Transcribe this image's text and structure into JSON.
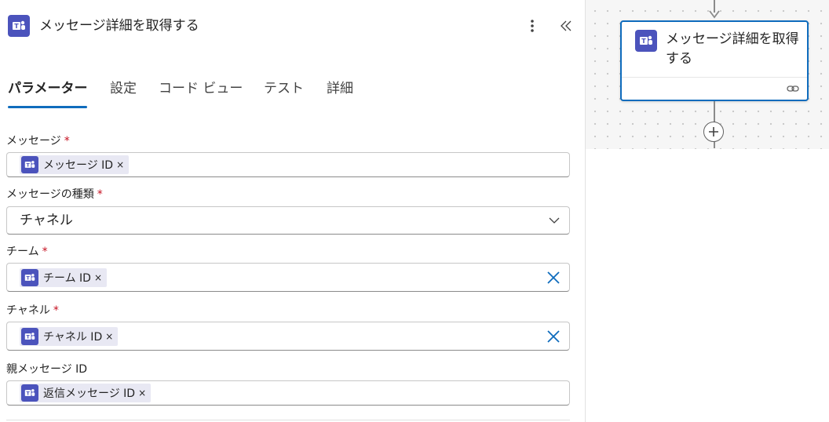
{
  "panel": {
    "title": "メッセージ詳細を取得する",
    "icon": "teams-icon",
    "more_icon": "more-vertical-icon",
    "collapse_icon": "double-chevron-left-icon",
    "tabs": [
      {
        "label": "パラメーター",
        "active": true
      },
      {
        "label": "設定",
        "active": false
      },
      {
        "label": "コード ビュー",
        "active": false
      },
      {
        "label": "テスト",
        "active": false
      },
      {
        "label": "詳細",
        "active": false
      }
    ],
    "required_mark": "*",
    "fields": {
      "message": {
        "label": "メッセージ",
        "required": true,
        "token": "メッセージ ID",
        "token_remove": "×"
      },
      "message_type": {
        "label": "メッセージの種類",
        "required": true,
        "value": "チャネル"
      },
      "team": {
        "label": "チーム",
        "required": true,
        "token": "チーム ID",
        "token_remove": "×"
      },
      "channel": {
        "label": "チャネル",
        "required": true,
        "token": "チャネル ID",
        "token_remove": "×"
      },
      "parent_message": {
        "label": "親メッセージ ID",
        "required": false,
        "token": "返信メッセージ ID",
        "token_remove": "×"
      }
    }
  },
  "canvas": {
    "card": {
      "title": "メッセージ詳細を取得する",
      "icon": "teams-icon",
      "link_icon": "link-icon"
    },
    "add_icon": "plus-circle-icon"
  },
  "colors": {
    "accent": "#0f6cbd",
    "teams": "#4b53bc",
    "required": "#c50f1f",
    "token_bg": "#e8e8f3"
  }
}
